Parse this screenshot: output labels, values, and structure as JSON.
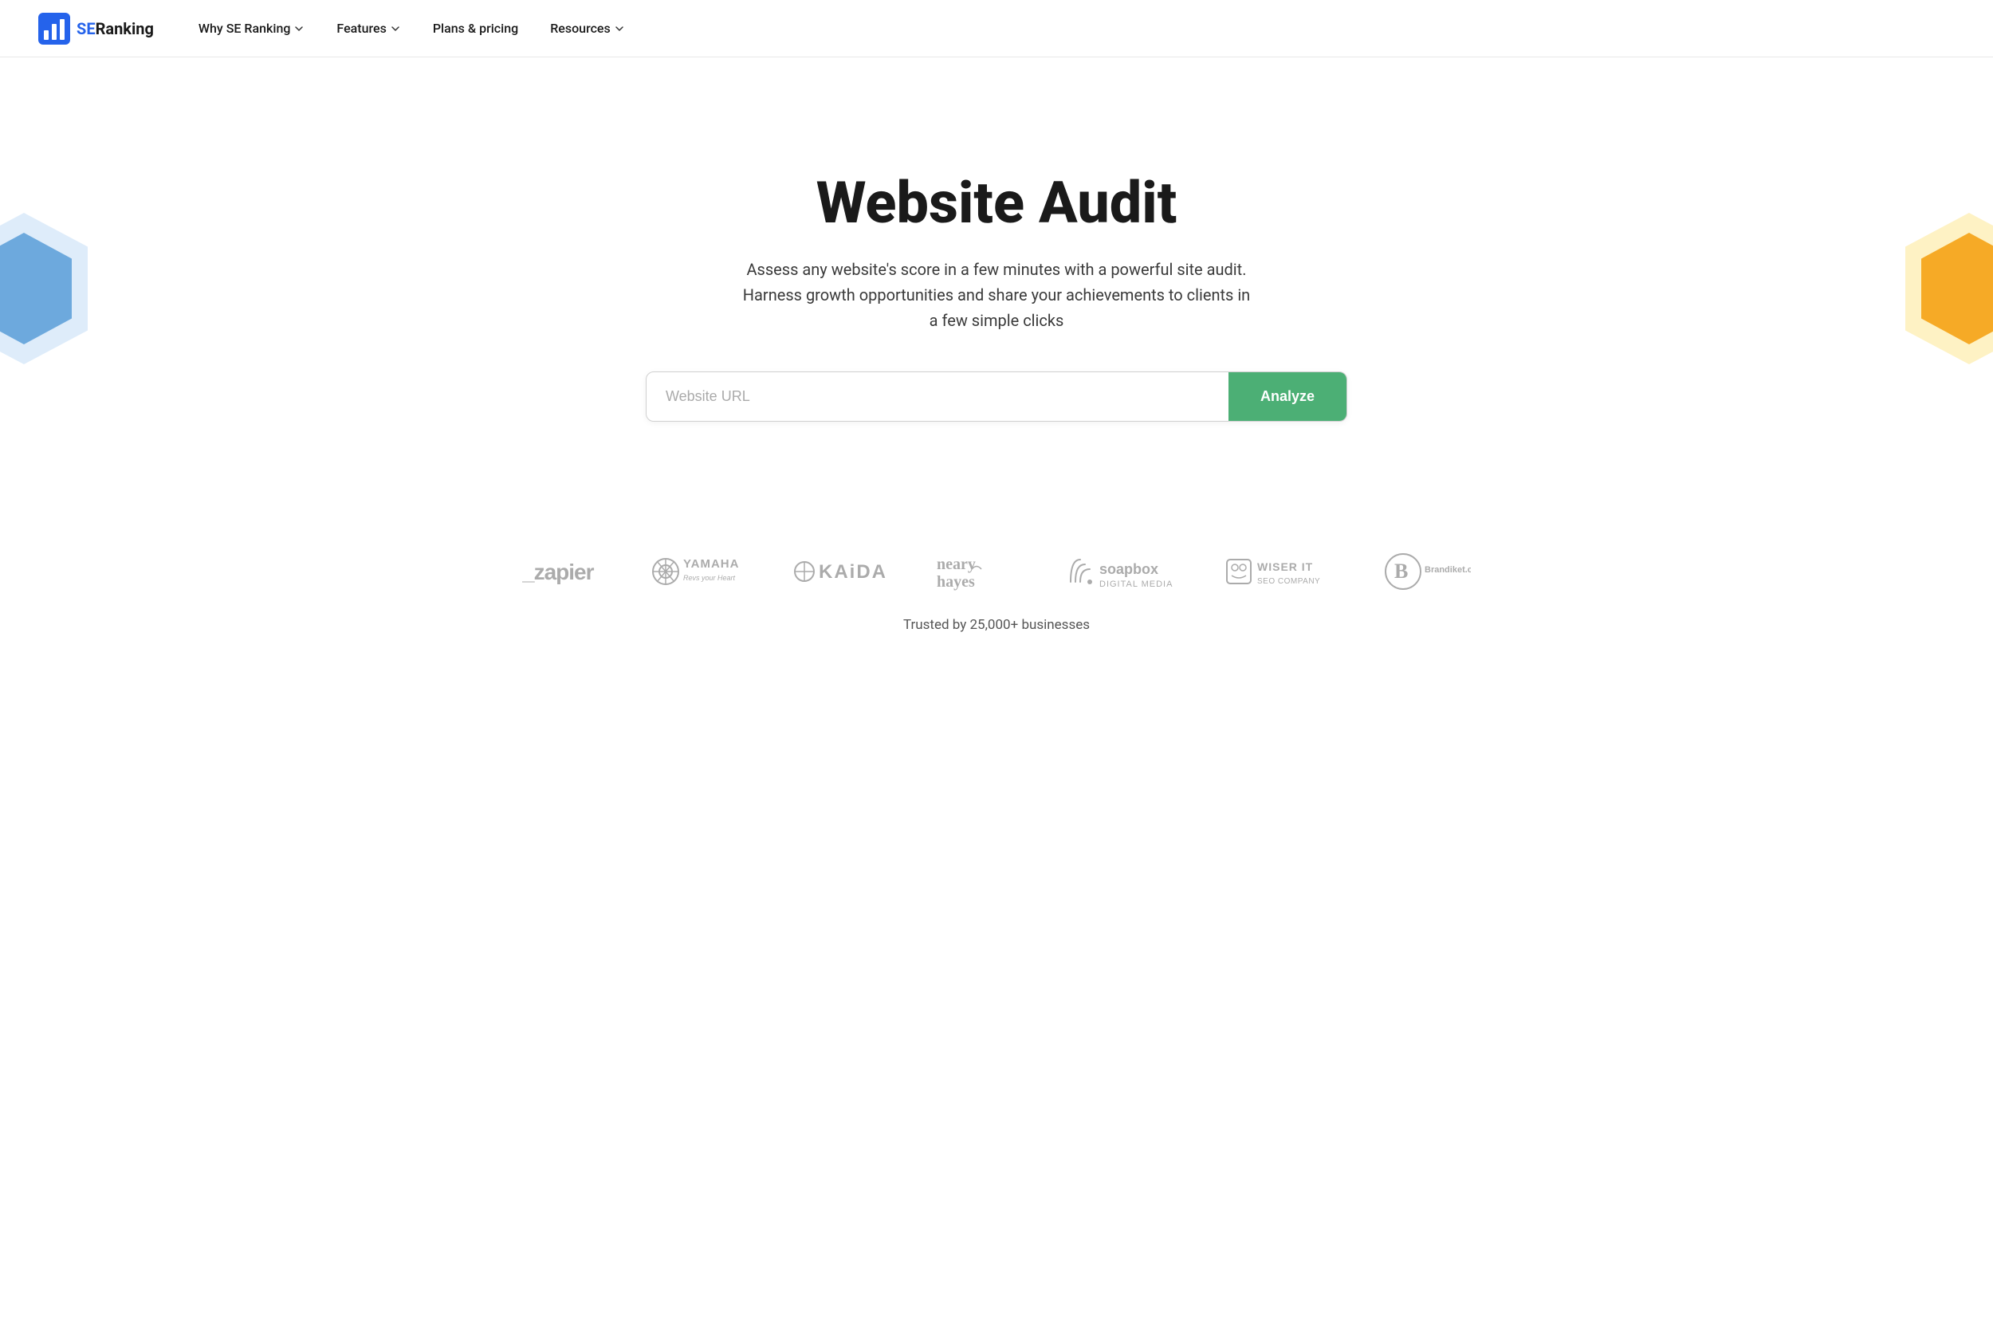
{
  "navbar": {
    "logo_text": "SE Ranking",
    "logo_se": "SE",
    "logo_ranking": "Ranking",
    "nav_items": [
      {
        "label": "Why SE Ranking",
        "has_dropdown": true
      },
      {
        "label": "Features",
        "has_dropdown": true
      },
      {
        "label": "Plans & pricing",
        "has_dropdown": false
      },
      {
        "label": "Resources",
        "has_dropdown": true
      }
    ]
  },
  "hero": {
    "title": "Website Audit",
    "subtitle": "Assess any website's score in a few minutes with a powerful site audit. Harness growth opportunities and share your achievements to clients in a few simple clicks",
    "search_placeholder": "Website URL",
    "analyze_button": "Analyze"
  },
  "logos": {
    "items": [
      {
        "name": "Zapier",
        "display": "_zapier"
      },
      {
        "name": "Yamaha",
        "display": "YAMAHA\nRevs your Heart"
      },
      {
        "name": "Kaida",
        "display": "⊙KAIDA"
      },
      {
        "name": "Neary Hayes",
        "display": "neary\nhayes"
      },
      {
        "name": "Soapbox Digital Media",
        "display": "soapbox\nDIGITAL MEDIA"
      },
      {
        "name": "Wiser IT SEO Company",
        "display": "WISER IT\nSEO COMPANY"
      },
      {
        "name": "Brandiket",
        "display": "B\nBrandiket.com"
      }
    ],
    "trusted_text": "Trusted by 25,000+ businesses"
  }
}
